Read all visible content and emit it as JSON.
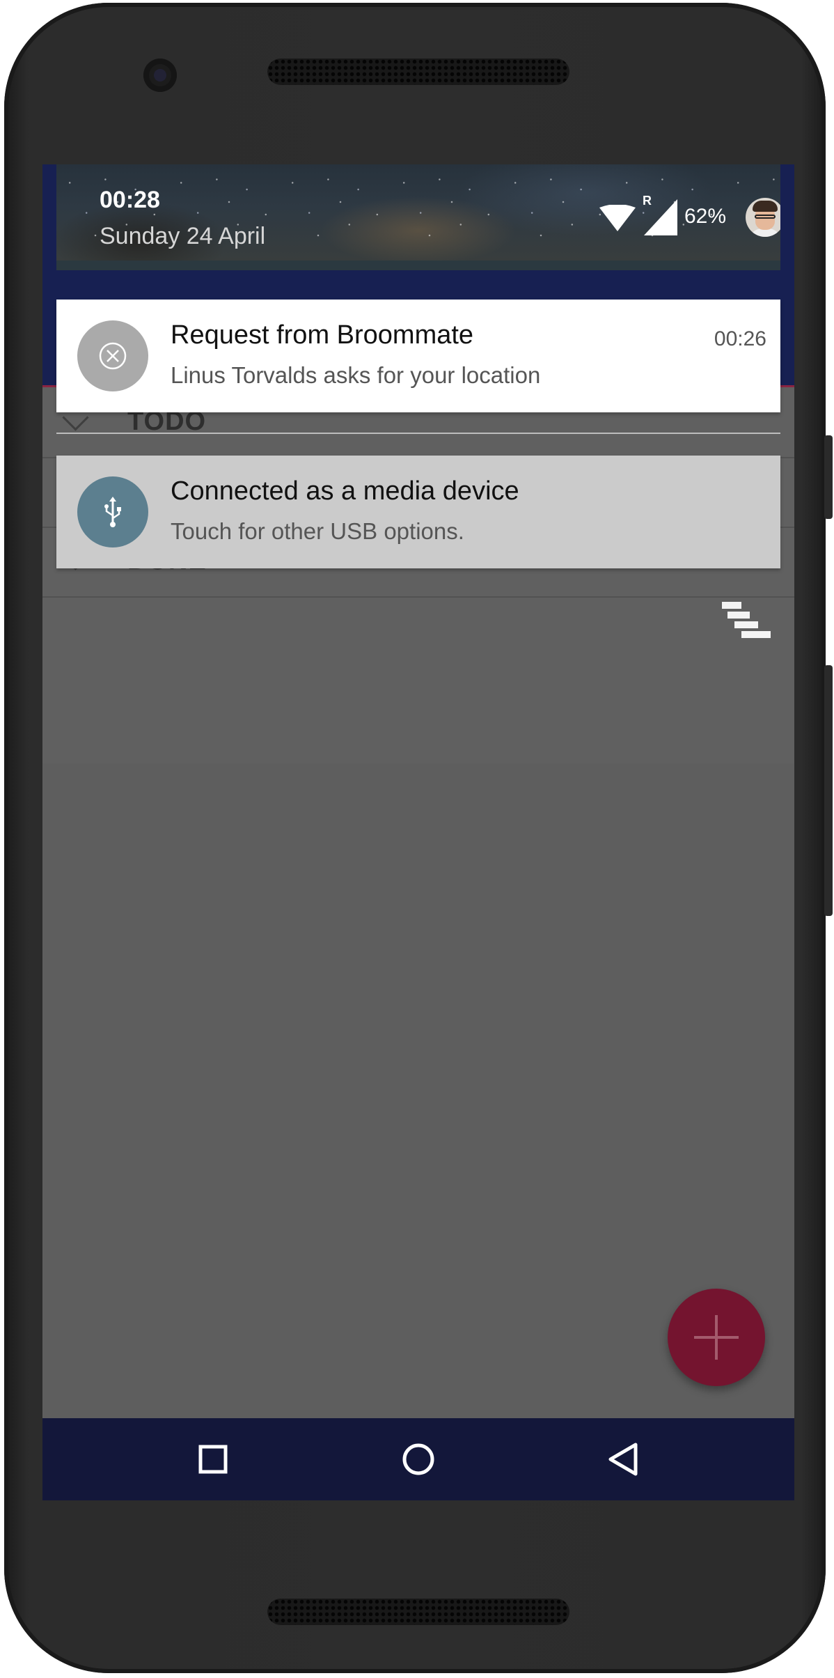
{
  "status": {
    "time": "00:28",
    "date": "Sunday 24 April",
    "roaming_indicator": "R",
    "battery": "62%",
    "icons": [
      "wifi-icon",
      "cellular-signal-icon",
      "avatar"
    ]
  },
  "app_background": {
    "sections": [
      {
        "label": "TODO"
      },
      {
        "label": "DONE"
      }
    ],
    "sort_icon": "sort-icon",
    "fab_icon": "plus-icon"
  },
  "notifications": [
    {
      "title": "Request from Broommate",
      "text": "Linus Torvalds asks for your location",
      "time": "00:26",
      "icon": "cancel-circle-icon"
    },
    {
      "title": "Connected as a media device",
      "text": "Touch for other USB options.",
      "icon": "usb-icon"
    }
  ],
  "navigation": {
    "buttons": [
      "recents-icon",
      "home-icon",
      "back-icon"
    ]
  },
  "colors": {
    "toolbar": "#172052",
    "navbar": "#13173a",
    "fab": "#74142f",
    "usb_icon_bg": "#5c7f8f",
    "scrim": "#5e5e5e"
  }
}
